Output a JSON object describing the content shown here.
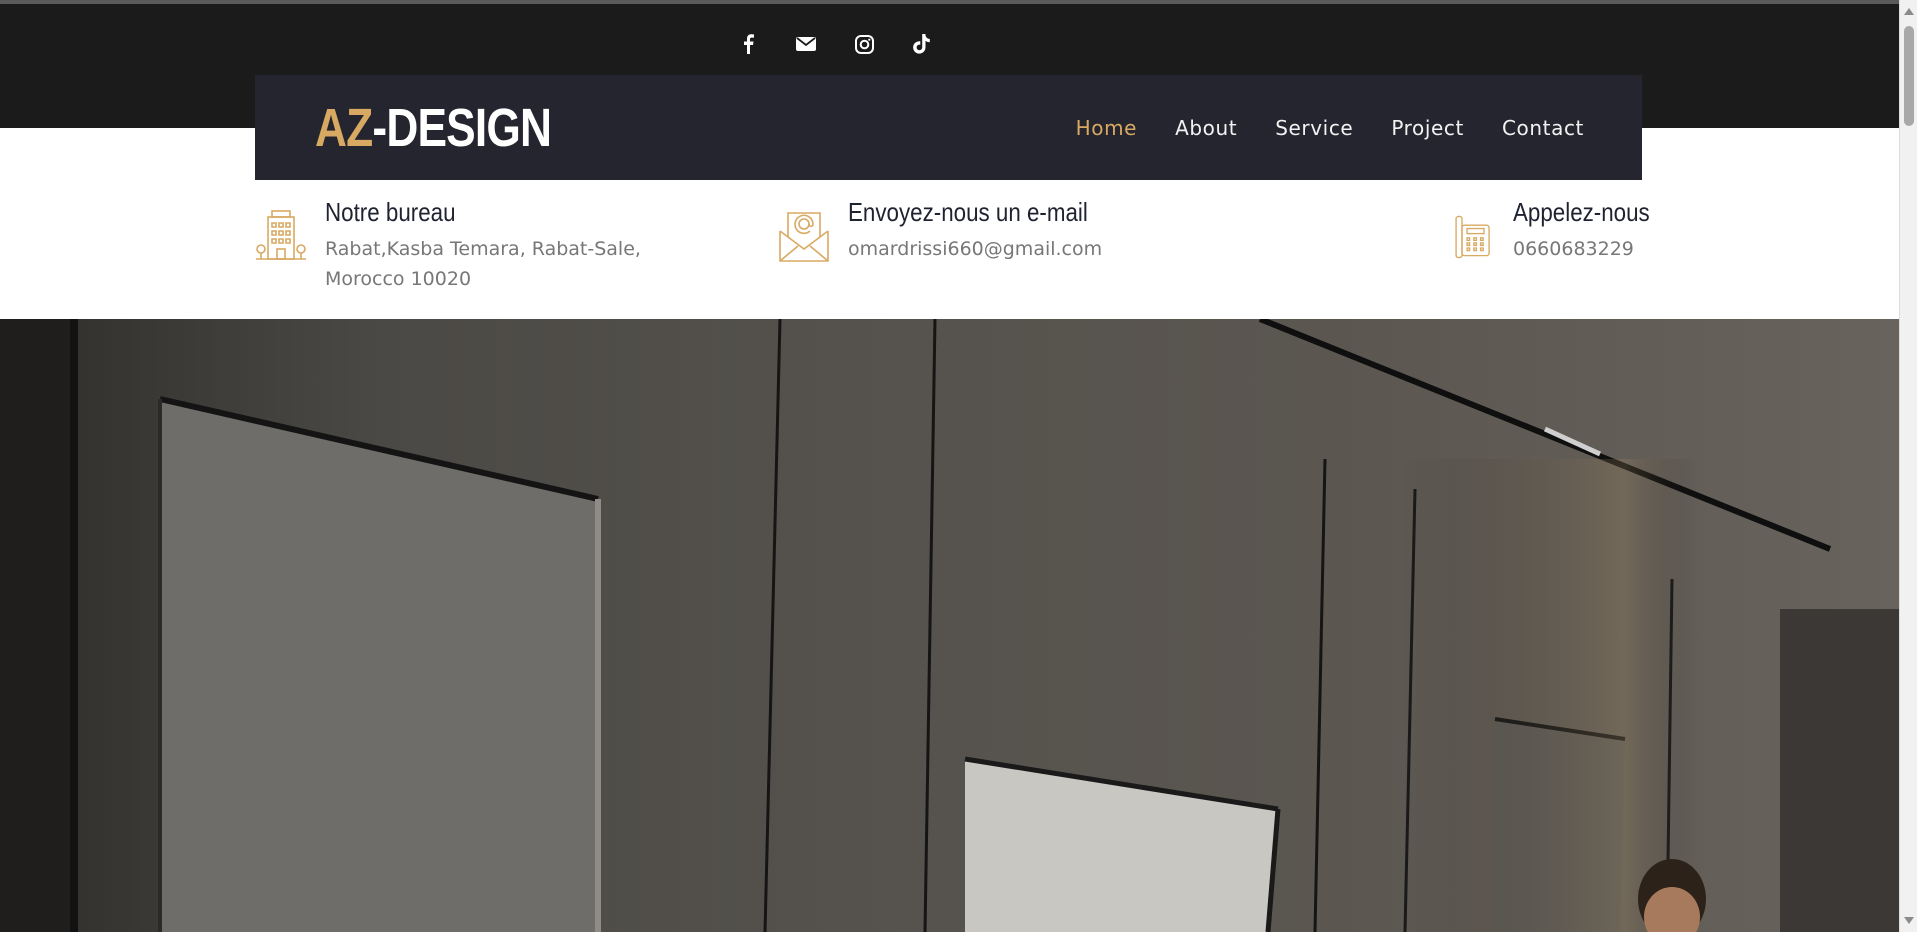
{
  "brand": {
    "logo_accent": "AZ",
    "logo_rest": "-DESIGN",
    "accent_color": "#d8a962",
    "navbar_color": "#25252f",
    "topbar_color": "#1b1b1b"
  },
  "social": [
    "facebook-icon",
    "envelope-icon",
    "instagram-icon",
    "tiktok-icon"
  ],
  "nav": {
    "items": [
      {
        "label": "Home",
        "active": true
      },
      {
        "label": "About",
        "active": false
      },
      {
        "label": "Service",
        "active": false
      },
      {
        "label": "Project",
        "active": false
      },
      {
        "label": "Contact",
        "active": false
      }
    ]
  },
  "info": {
    "office": {
      "title": "Notre bureau",
      "text": "Rabat,Kasba Temara, Rabat-Sale,\nMorocco 10020",
      "icon": "building-icon"
    },
    "email": {
      "title": "Envoyez-nous un e-mail",
      "text": "omardrissi660@gmail.com",
      "icon": "mail-icon"
    },
    "phone": {
      "title": "Appelez-nous",
      "text": "0660683229",
      "icon": "telephone-icon"
    }
  }
}
